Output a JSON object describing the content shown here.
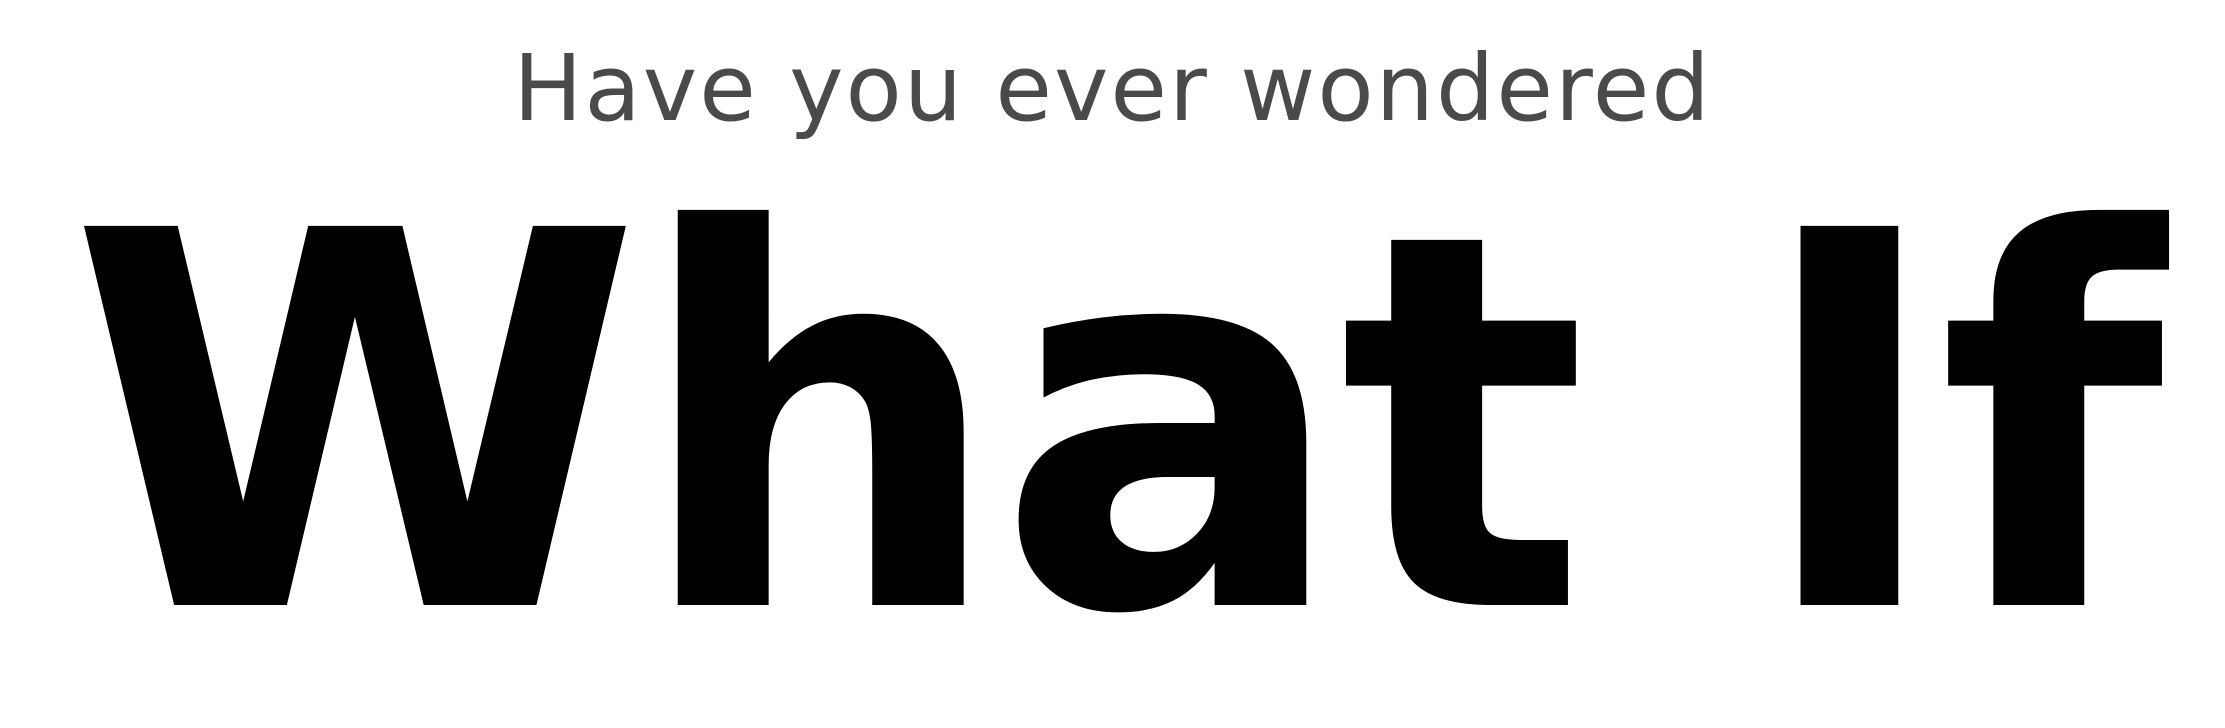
{
  "subtitle": "Have you ever wondered",
  "headline": "What If",
  "colors": {
    "background": "#ffffff",
    "subtitle": "#4a4a4a",
    "headline": "#000000"
  }
}
